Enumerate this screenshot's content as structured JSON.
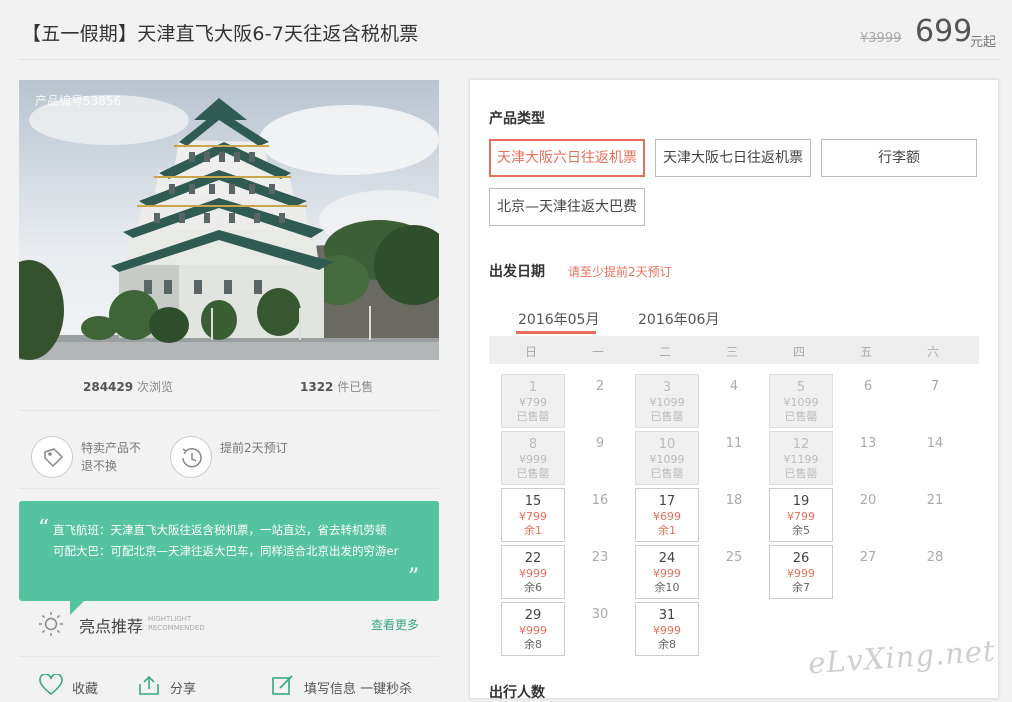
{
  "header": {
    "title": "【五一假期】天津直飞大阪6-7天往返含税机票",
    "original_price": "¥3999",
    "price": "699",
    "price_unit": "元起"
  },
  "photo": {
    "product_id": "产品编号53856"
  },
  "stats": {
    "views_num": "284429",
    "views_label": "次浏览",
    "sold_num": "1322",
    "sold_label": "件已售"
  },
  "features": [
    {
      "icon": "tag-icon",
      "text": "特卖产品不退不换"
    },
    {
      "icon": "clock-history-icon",
      "text": "提前2天预订"
    }
  ],
  "recommend_box": {
    "open_quote": "“",
    "close_quote": "”",
    "line1": "直飞航班：天津直飞大阪往返含税机票，一站直达，省去转机劳顿",
    "line2": "可配大巴：可配北京—天津往返大巴车，同样适合北京出发的穷游er"
  },
  "highlight": {
    "title": "亮点推荐",
    "sub1": "HIGHTLIGHT",
    "sub2": "RECOMMENDED",
    "more": "查看更多"
  },
  "actions": {
    "favorite": "收藏",
    "share": "分享",
    "book": "填写信息 一键秒杀"
  },
  "booking": {
    "product_type_heading": "产品类型",
    "options": [
      "天津大阪六日往返机票",
      "天津大阪七日往返机票",
      "行李额",
      "北京—天津往返大巴费"
    ],
    "selected_option_index": 0,
    "date_heading": "出发日期",
    "date_note": "请至少提前2天预订",
    "month_tabs": [
      "2016年05月",
      "2016年06月"
    ],
    "active_month_index": 0,
    "weekdays": [
      "日",
      "一",
      "二",
      "三",
      "四",
      "五",
      "六"
    ],
    "people_heading": "出行人数"
  },
  "calendar": [
    [
      {
        "day": "1",
        "state": "sold",
        "price": "¥799",
        "status": "已售罄"
      },
      {
        "day": "2",
        "state": "none"
      },
      {
        "day": "3",
        "state": "sold",
        "price": "¥1099",
        "status": "已售罄"
      },
      {
        "day": "4",
        "state": "none"
      },
      {
        "day": "5",
        "state": "sold",
        "price": "¥1099",
        "status": "已售罄"
      },
      {
        "day": "6",
        "state": "none"
      },
      {
        "day": "7",
        "state": "none"
      }
    ],
    [
      {
        "day": "8",
        "state": "sold",
        "price": "¥999",
        "status": "已售罄"
      },
      {
        "day": "9",
        "state": "none"
      },
      {
        "day": "10",
        "state": "sold",
        "price": "¥1099",
        "status": "已售罄"
      },
      {
        "day": "11",
        "state": "none"
      },
      {
        "day": "12",
        "state": "sold",
        "price": "¥1199",
        "status": "已售罄"
      },
      {
        "day": "13",
        "state": "none"
      },
      {
        "day": "14",
        "state": "none"
      }
    ],
    [
      {
        "day": "15",
        "state": "avail",
        "price": "¥799",
        "status": "余1"
      },
      {
        "day": "16",
        "state": "none"
      },
      {
        "day": "17",
        "state": "avail",
        "price": "¥699",
        "status": "余1"
      },
      {
        "day": "18",
        "state": "none"
      },
      {
        "day": "19",
        "state": "avail",
        "price": "¥799",
        "status": "余5"
      },
      {
        "day": "20",
        "state": "none"
      },
      {
        "day": "21",
        "state": "none"
      }
    ],
    [
      {
        "day": "22",
        "state": "avail",
        "price": "¥999",
        "status": "余6"
      },
      {
        "day": "23",
        "state": "none"
      },
      {
        "day": "24",
        "state": "avail",
        "price": "¥999",
        "status": "余10"
      },
      {
        "day": "25",
        "state": "none"
      },
      {
        "day": "26",
        "state": "avail",
        "price": "¥999",
        "status": "余7"
      },
      {
        "day": "27",
        "state": "none"
      },
      {
        "day": "28",
        "state": "none"
      }
    ],
    [
      {
        "day": "29",
        "state": "avail",
        "price": "¥999",
        "status": "余8"
      },
      {
        "day": "30",
        "state": "none"
      },
      {
        "day": "31",
        "state": "avail",
        "price": "¥999",
        "status": "余8"
      }
    ]
  ],
  "watermark": "eLvXing.net",
  "colors": {
    "accent": "#e7705c",
    "green": "#55c3a0",
    "link_green": "#3aaa82"
  }
}
